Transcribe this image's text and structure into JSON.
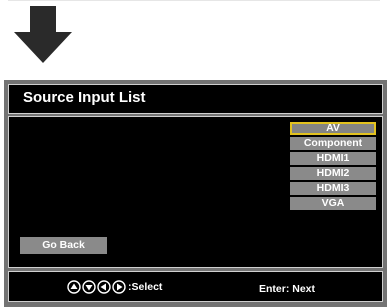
{
  "title": "Source Input List",
  "sources": [
    {
      "label": "AV",
      "selected": true
    },
    {
      "label": "Component",
      "selected": false
    },
    {
      "label": "HDMI1",
      "selected": false
    },
    {
      "label": "HDMI2",
      "selected": false
    },
    {
      "label": "HDMI3",
      "selected": false
    },
    {
      "label": "VGA",
      "selected": false
    }
  ],
  "go_back_label": "Go Back",
  "footer": {
    "select_hint": ":Select",
    "enter_hint": "Enter: Next",
    "nav_icons": [
      "up-icon",
      "down-icon",
      "left-icon",
      "right-icon"
    ]
  },
  "colors": {
    "highlight": "#e2c21f",
    "item_bg": "#8a8a8a",
    "panel_bg": "#000000",
    "frame_bg": "#737373"
  }
}
